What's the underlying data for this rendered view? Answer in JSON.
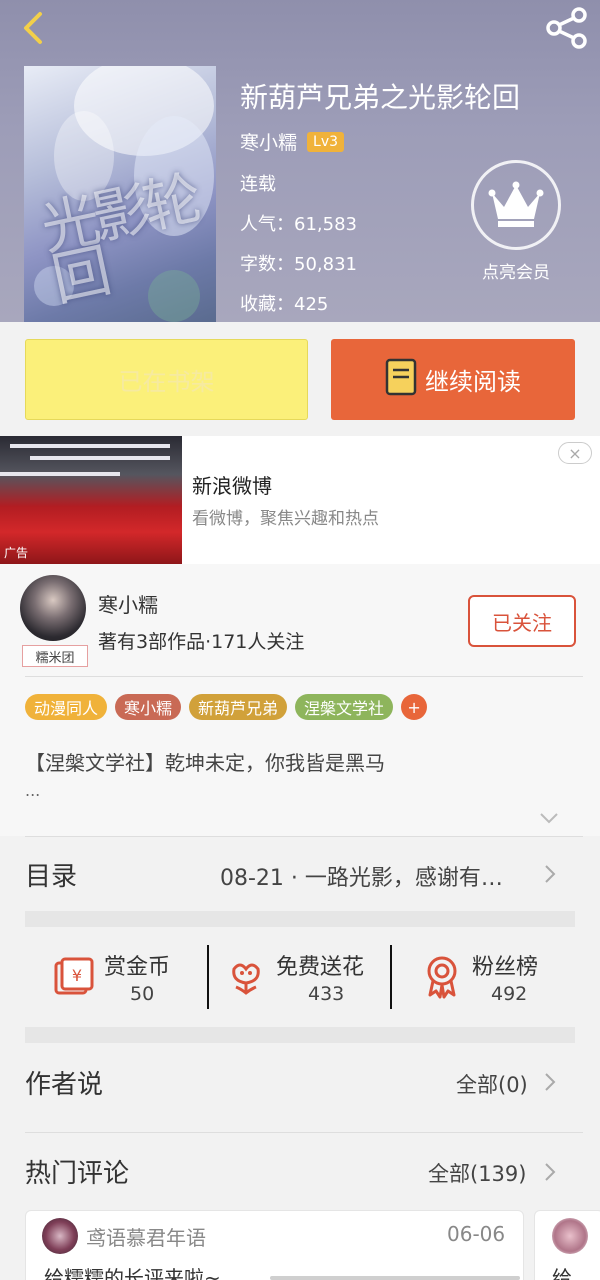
{
  "book": {
    "title": "新葫芦兄弟之光影轮回",
    "cover_text": "光影轮回",
    "author": "寒小糯",
    "level": "Lv3",
    "status": "连载",
    "popularity": "人气：61,583",
    "word_count": "字数：50,831",
    "favorites": "收藏：425"
  },
  "vip": {
    "label": "点亮会员"
  },
  "actions": {
    "shelf_label": "已在书架",
    "read_label": "继续阅读"
  },
  "ad": {
    "title": "新浪微博",
    "desc": "看微博，聚焦兴趣和热点",
    "tag": "广告",
    "close": "×"
  },
  "author_card": {
    "name": "寒小糯",
    "info": "著有3部作品·171人关注",
    "fan_group": "糯米团",
    "follow_label": "已关注",
    "tags": [
      {
        "label": "动漫同人",
        "color": "#f0b23a"
      },
      {
        "label": "寒小糯",
        "color": "#c96a55"
      },
      {
        "label": "新葫芦兄弟",
        "color": "#d1a13a"
      },
      {
        "label": "涅槃文学社",
        "color": "#8eb55c"
      }
    ],
    "tag_more": "+",
    "intro": "【涅槃文学社】乾坤未定，你我皆是黑马",
    "intro_more": "..."
  },
  "catalog": {
    "label": "目录",
    "latest": "08-21 · 一路光影，感谢有…"
  },
  "stats": [
    {
      "label": "赏金币",
      "value": "50",
      "icon": "red-packet-icon"
    },
    {
      "label": "免费送花",
      "value": "433",
      "icon": "flower-icon"
    },
    {
      "label": "粉丝榜",
      "value": "492",
      "icon": "medal-icon"
    }
  ],
  "author_says": {
    "label": "作者说",
    "link": "全部(0)"
  },
  "hot_comments": {
    "label": "热门评论",
    "link": "全部(139)",
    "items": [
      {
        "user": "鸢语慕君年语",
        "date": "06-06",
        "text": "给糯糯的长评来啦~"
      },
      {
        "user": "",
        "date": "",
        "text": "给"
      }
    ]
  },
  "colors": {
    "accent": "#e8663a",
    "follow": "#d9533b",
    "shelf": "#fbf07a"
  }
}
